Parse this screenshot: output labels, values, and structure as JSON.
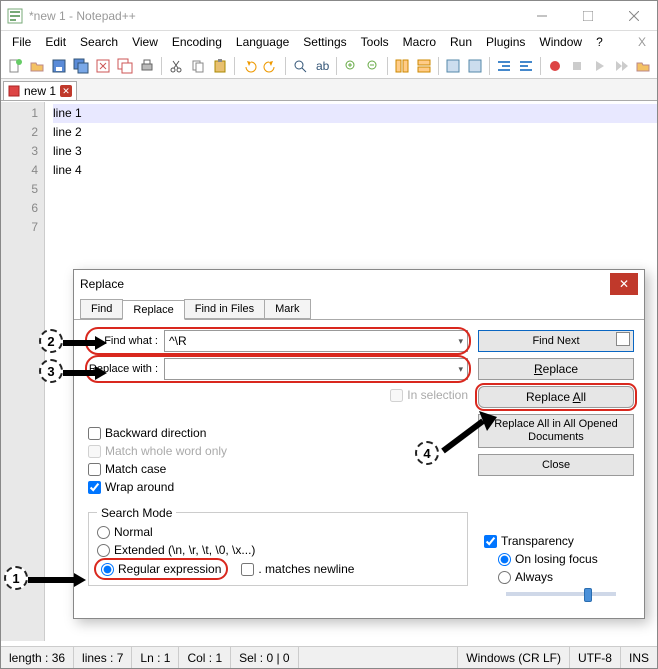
{
  "window": {
    "title": "*new 1 - Notepad++"
  },
  "menus": [
    "File",
    "Edit",
    "Search",
    "View",
    "Encoding",
    "Language",
    "Settings",
    "Tools",
    "Macro",
    "Run",
    "Plugins",
    "Window",
    "?"
  ],
  "tab": {
    "label": "new 1"
  },
  "editor_lines": [
    "line 1",
    "",
    "",
    "line 2",
    "",
    "line 3",
    "line 4"
  ],
  "dialog": {
    "title": "Replace",
    "tabs": [
      "Find",
      "Replace",
      "Find in Files",
      "Mark"
    ],
    "find_label": "Find what :",
    "find_value": "^\\R",
    "replace_label": "Replace with :",
    "replace_value": "",
    "in_selection": "In selection",
    "checks": {
      "backward": "Backward direction",
      "whole_word": "Match whole word only",
      "match_case": "Match case",
      "wrap": "Wrap around"
    },
    "search_mode": {
      "legend": "Search Mode",
      "normal": "Normal",
      "extended": "Extended (\\n, \\r, \\t, \\0, \\x...)",
      "regex": "Regular expression",
      "dot_newline": ". matches newline"
    },
    "buttons": {
      "find_next": "Find Next",
      "replace": "Replace",
      "replace_all": "Replace All",
      "replace_all_docs": "Replace All in All Opened Documents",
      "close": "Close"
    },
    "transparency": {
      "label": "Transparency",
      "losing_focus": "On losing focus",
      "always": "Always"
    }
  },
  "status": {
    "length": "length : 36",
    "lines": "lines : 7",
    "ln": "Ln : 1",
    "col": "Col : 1",
    "sel": "Sel : 0 | 0",
    "eol": "Windows (CR LF)",
    "enc": "UTF-8",
    "mode": "INS"
  },
  "annot": {
    "n1": "1",
    "n2": "2",
    "n3": "3",
    "n4": "4"
  }
}
